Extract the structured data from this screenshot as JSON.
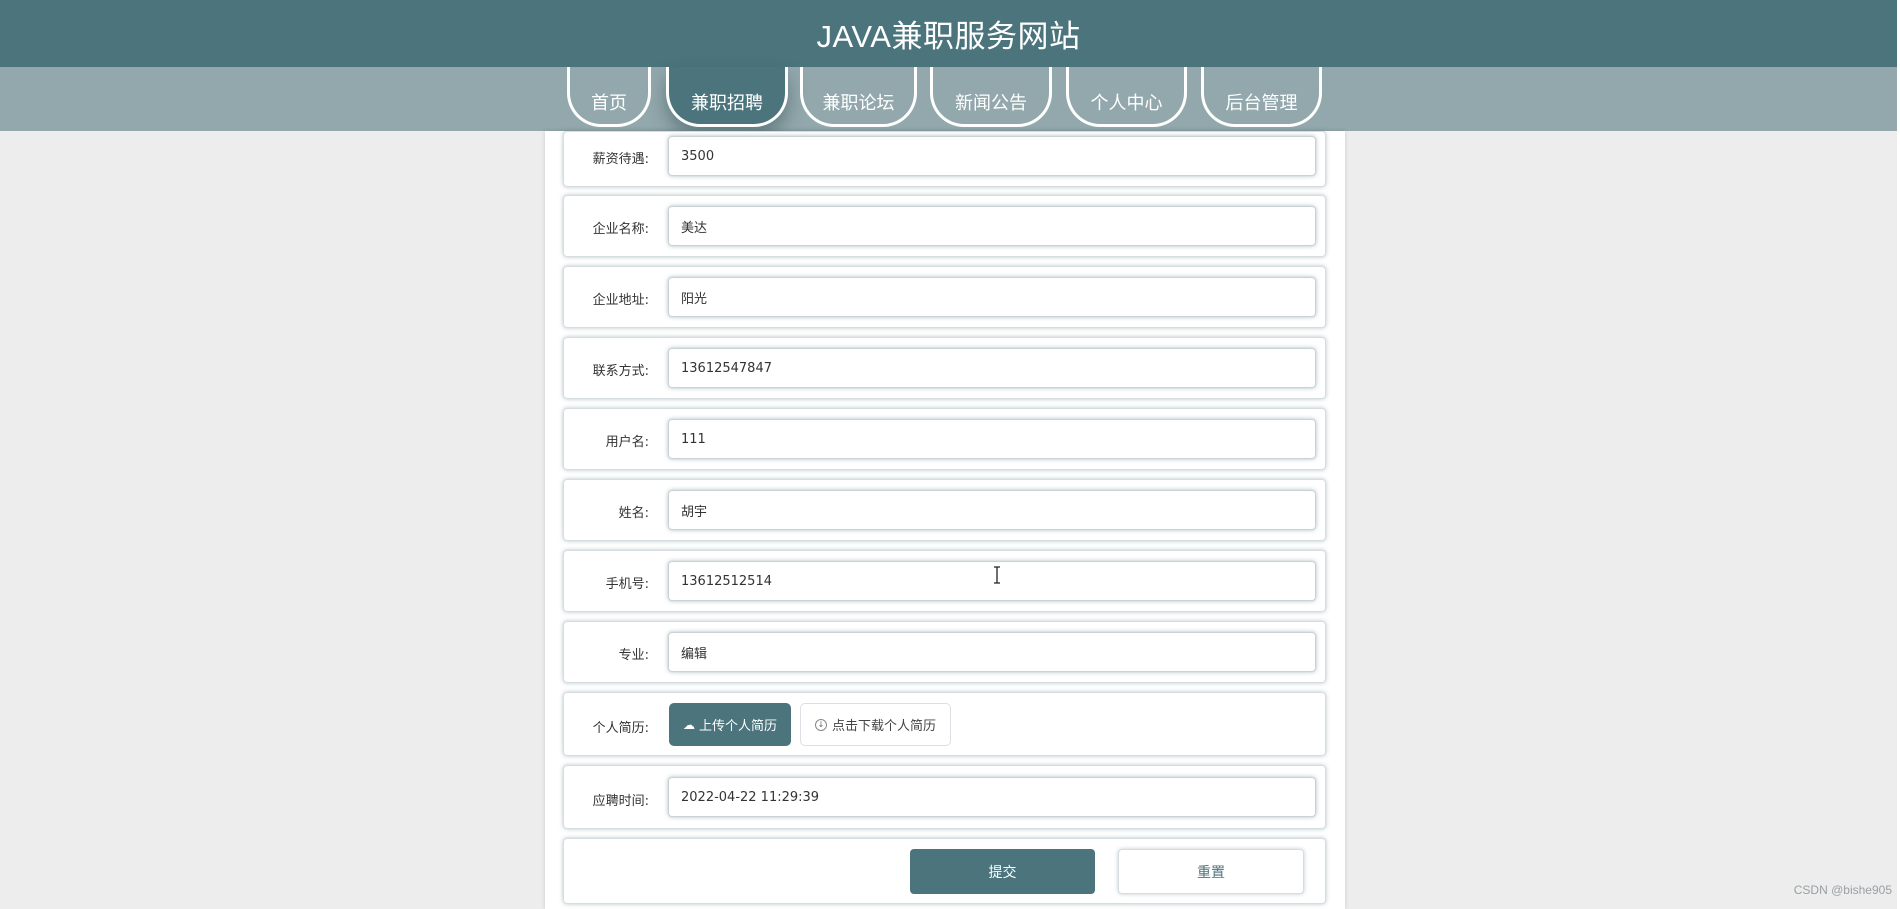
{
  "header": {
    "title": "JAVA兼职服务网站"
  },
  "nav": {
    "items": [
      {
        "label": "首页"
      },
      {
        "label": "兼职招聘"
      },
      {
        "label": "兼职论坛"
      },
      {
        "label": "新闻公告"
      },
      {
        "label": "个人中心"
      },
      {
        "label": "后台管理"
      }
    ],
    "active": "兼职招聘"
  },
  "form": {
    "fields": [
      {
        "label": "薪资待遇:",
        "value": "3500"
      },
      {
        "label": "企业名称:",
        "value": "美达"
      },
      {
        "label": "企业地址:",
        "value": "阳光"
      },
      {
        "label": "联系方式:",
        "value": "13612547847"
      },
      {
        "label": "用户名:",
        "value": "111"
      },
      {
        "label": "姓名:",
        "value": "胡宇"
      },
      {
        "label": "手机号:",
        "value": "13612512514"
      },
      {
        "label": "专业:",
        "value": "编辑"
      }
    ],
    "resume": {
      "label": "个人简历:",
      "upload_label": "上传个人简历",
      "download_label": "点击下载个人简历"
    },
    "apply_time": {
      "label": "应聘时间:",
      "value": "2022-04-22 11:29:39"
    },
    "submit_label": "提交",
    "reset_label": "重置"
  },
  "watermark": "CSDN @bishe905",
  "colors": {
    "primary": "#4b747d",
    "nav_bg": "#93a8ad",
    "page_bg": "#ededed"
  }
}
